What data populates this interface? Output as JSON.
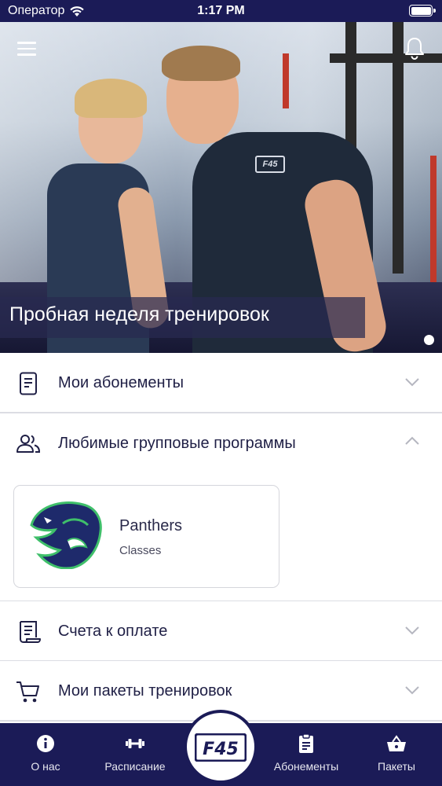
{
  "status_bar": {
    "carrier": "Оператор",
    "time": "1:17 PM"
  },
  "hero": {
    "caption": "Пробная неделя тренировок",
    "shirt_logo": "F45",
    "icons": {
      "menu": "hamburger-menu-icon",
      "notifications": "bell-icon"
    },
    "carousel_pages": 1
  },
  "sections": {
    "memberships": {
      "label": "Мои абонементы",
      "icon": "document-icon",
      "expanded": false
    },
    "favorite_programs": {
      "label": "Любимые групповые программы",
      "icon": "people-icon",
      "expanded": true,
      "cards": [
        {
          "title": "Panthers",
          "subtitle": "Classes",
          "logo": "panther-logo"
        }
      ]
    },
    "invoices": {
      "label": "Счета к оплате",
      "icon": "receipt-icon",
      "expanded": false
    },
    "packages": {
      "label": "Мои пакеты тренировок",
      "icon": "cart-icon",
      "expanded": false
    }
  },
  "tabbar": {
    "items": [
      {
        "label": "О нас",
        "icon": "info-icon"
      },
      {
        "label": "Расписание",
        "icon": "dumbbell-icon"
      },
      {
        "label": "Абонементы",
        "icon": "clipboard-icon"
      },
      {
        "label": "Пакеты",
        "icon": "basket-icon"
      }
    ],
    "center_logo": "F45"
  },
  "colors": {
    "primary": "#1b1b57",
    "text": "#1f1f45",
    "divider": "#dcdde3",
    "panther_green": "#3fbf6a"
  }
}
